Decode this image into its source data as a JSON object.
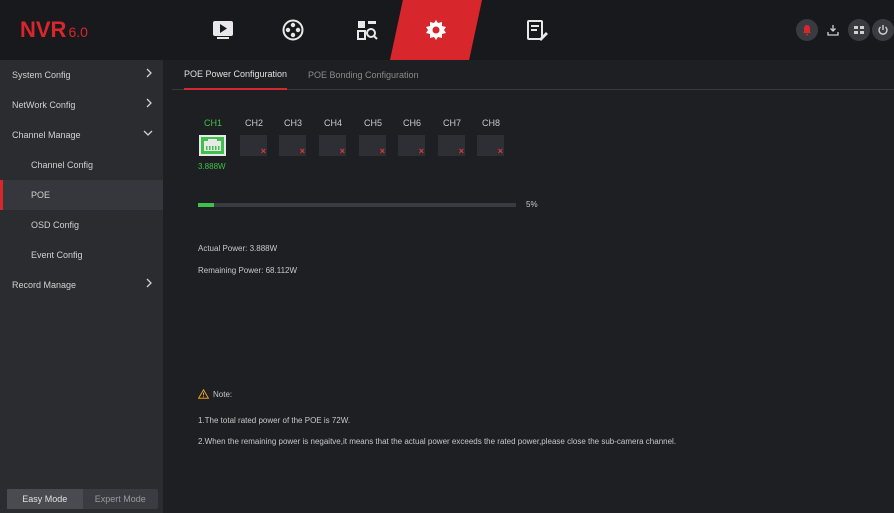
{
  "app": {
    "logo": "NVR",
    "version": "6.0"
  },
  "topnav": [
    {
      "icon": "playback-icon"
    },
    {
      "icon": "network-icon"
    },
    {
      "icon": "search-icon"
    },
    {
      "icon": "gear-icon"
    },
    {
      "icon": "maintenance-icon"
    }
  ],
  "topright": [
    "alarm-icon",
    "download-icon",
    "device-icon",
    "power-icon"
  ],
  "sidebar": {
    "items": [
      {
        "label": "System Config"
      },
      {
        "label": "NetWork Config"
      },
      {
        "label": "Channel Manage"
      },
      {
        "label": "Channel Config"
      },
      {
        "label": "POE"
      },
      {
        "label": "OSD Config"
      },
      {
        "label": "Event Config"
      },
      {
        "label": "Record Manage"
      }
    ],
    "modes": [
      "Easy Mode",
      "Expert Mode"
    ]
  },
  "tabs": [
    "POE Power Configuration",
    "POE Bonding Configuration"
  ],
  "channels": [
    "CH1",
    "CH2",
    "CH3",
    "CH4",
    "CH5",
    "CH6",
    "CH7",
    "CH8"
  ],
  "ch1_power": "3.888W",
  "progress": {
    "value": 5,
    "label": "5%"
  },
  "actual_power": "Actual Power: 3.888W",
  "remaining_power": "Remaining Power: 68.112W",
  "note": {
    "title": "Note:",
    "line1": "1.The total rated power of the POE is 72W.",
    "line2": "2.When the remaining power is negaitve,it means that the actual power exceeds the rated power,please close the sub-camera channel."
  },
  "colors": {
    "accent": "#d8262d",
    "ok": "#3ec14a",
    "bg": "#1e1f23",
    "sidebar": "#2b2c30"
  }
}
